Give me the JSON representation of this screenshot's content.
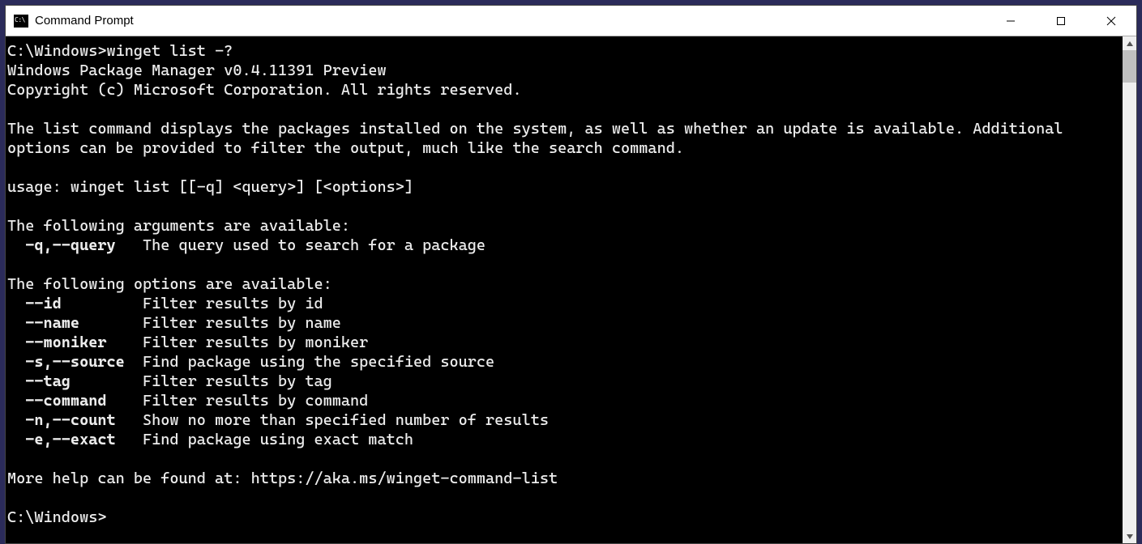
{
  "window": {
    "title": "Command Prompt"
  },
  "terminal": {
    "prompt1_path": "C:\\Windows>",
    "prompt1_cmd": "winget list -?",
    "version_line": "Windows Package Manager v0.4.11391 Preview",
    "copyright_line": "Copyright (c) Microsoft Corporation. All rights reserved.",
    "description": "The list command displays the packages installed on the system, as well as whether an update is available. Additional options can be provided to filter the output, much like the search command.",
    "usage_line": "usage: winget list [[-q] <query>] [<options>]",
    "args_heading": "The following arguments are available:",
    "args": [
      {
        "flag": "-q,--query",
        "desc": "The query used to search for a package"
      }
    ],
    "options_heading": "The following options are available:",
    "options": [
      {
        "flag": "--id",
        "desc": "Filter results by id"
      },
      {
        "flag": "--name",
        "desc": "Filter results by name"
      },
      {
        "flag": "--moniker",
        "desc": "Filter results by moniker"
      },
      {
        "flag": "-s,--source",
        "desc": "Find package using the specified source"
      },
      {
        "flag": "--tag",
        "desc": "Filter results by tag"
      },
      {
        "flag": "--command",
        "desc": "Filter results by command"
      },
      {
        "flag": "-n,--count",
        "desc": "Show no more than specified number of results"
      },
      {
        "flag": "-e,--exact",
        "desc": "Find package using exact match"
      }
    ],
    "help_line": "More help can be found at: https://aka.ms/winget-command-list",
    "prompt2_path": "C:\\Windows>"
  }
}
